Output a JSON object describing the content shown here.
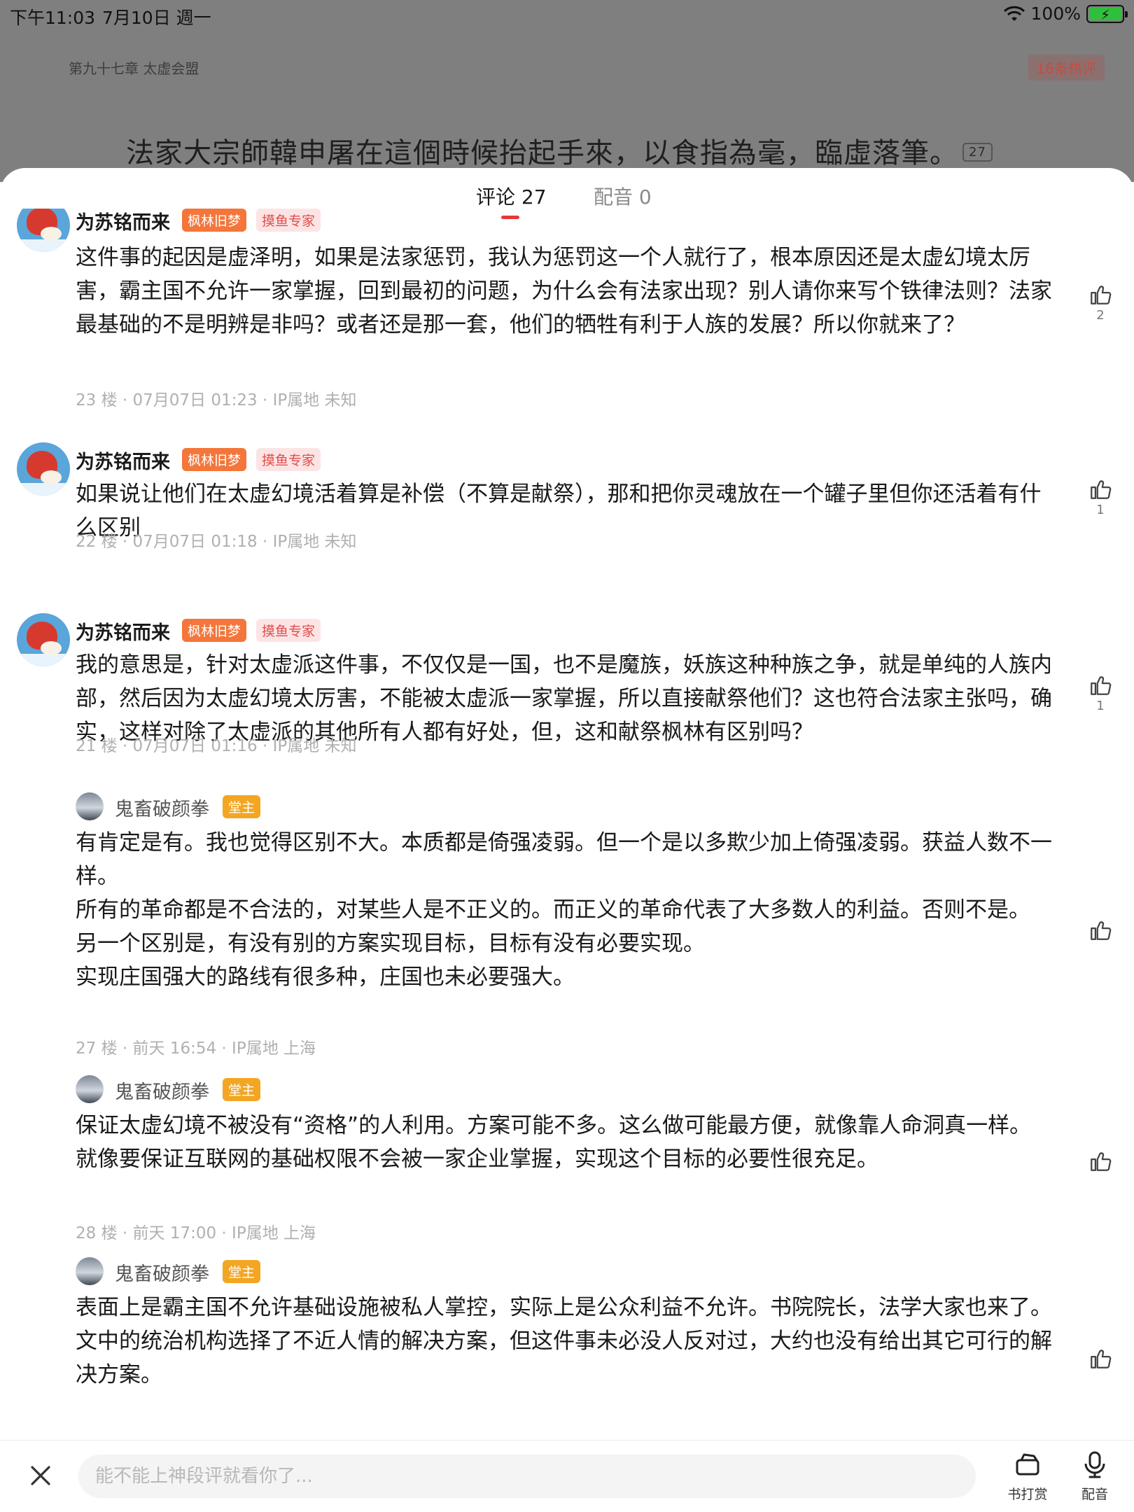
{
  "status_bar": {
    "time": "下午11:03",
    "date": "7月10日 週一",
    "battery": "100%"
  },
  "reader": {
    "chapter_title": "第九十七章 太虚会盟",
    "hot_comments": "16条热评",
    "line": "法家大宗師韓申屠在這個時候抬起手來，以食指為毫，臨虛落筆。",
    "line_comment_count": "27"
  },
  "tabs": {
    "comments": "评论 27",
    "dubbing": "配音 0"
  },
  "comments": [
    {
      "user": "为苏铭而来",
      "badge1": "枫林旧梦",
      "badge2": "摸鱼专家",
      "text": "这件事的起因是虚泽明，如果是法家惩罚，我认为惩罚这一个人就行了，根本原因还是太虚幻境太厉害，霸主国不允许一家掌握，回到最初的问题，为什么会有法家出现？别人请你来写个铁律法则？法家最基础的不是明辨是非吗？或者还是那一套，他们的牺牲有利于人族的发展？所以你就来了？",
      "meta": "23 楼 · 07月07日 01:23 · IP属地 未知",
      "likes": "2"
    },
    {
      "user": "为苏铭而来",
      "badge1": "枫林旧梦",
      "badge2": "摸鱼专家",
      "text": "如果说让他们在太虚幻境活着算是补偿（不算是献祭），那和把你灵魂放在一个罐子里但你还活着有什么区别",
      "meta": "22 楼 · 07月07日 01:18 · IP属地 未知",
      "likes": "1"
    },
    {
      "user": "为苏铭而来",
      "badge1": "枫林旧梦",
      "badge2": "摸鱼专家",
      "text": "我的意思是，针对太虚派这件事，不仅仅是一国，也不是魔族，妖族这种种族之争，就是单纯的人族内部，然后因为太虚幻境太厉害，不能被太虚派一家掌握，所以直接献祭他们？这也符合法家主张吗，确实，这样对除了太虚派的其他所有人都有好处，但，这和献祭枫林有区别吗？",
      "meta": "21 楼 · 07月07日 01:16 · IP属地 未知",
      "likes": "1"
    }
  ],
  "replies": [
    {
      "user": "鬼畜破颜拳",
      "badge": "堂主",
      "lines": [
        "有肯定是有。我也觉得区别不大。本质都是倚强凌弱。但一个是以多欺少加上倚强凌弱。获益人数不一样。",
        "所有的革命都是不合法的，对某些人是不正义的。而正义的革命代表了大多数人的利益。否则不是。",
        "另一个区别是，有没有别的方案实现目标，目标有没有必要实现。",
        "实现庄国强大的路线有很多种，庄国也未必要强大。"
      ],
      "meta": "27 楼 · 前天 16:54 · IP属地 上海"
    },
    {
      "user": "鬼畜破颜拳",
      "badge": "堂主",
      "lines": [
        "保证太虚幻境不被没有“资格”的人利用。方案可能不多。这么做可能最方便，就像靠人命洞真一样。",
        "就像要保证互联网的基础权限不会被一家企业掌握，实现这个目标的必要性很充足。"
      ],
      "meta": "28 楼 · 前天 17:00 · IP属地 上海"
    },
    {
      "user": "鬼畜破颜拳",
      "badge": "堂主",
      "lines": [
        "表面上是霸主国不允许基础设施被私人掌控，实际上是公众利益不允许。书院院长，法学大家也来了。",
        "文中的统治机构选择了不近人情的解决方案，但这件事未必没人反对过，大约也没有给出其它可行的解决方案。"
      ],
      "meta": ""
    }
  ],
  "bottom_bar": {
    "input_placeholder": "能不能上神段评就看你了...",
    "reward_label": "书打赏",
    "dub_label": "配音"
  }
}
